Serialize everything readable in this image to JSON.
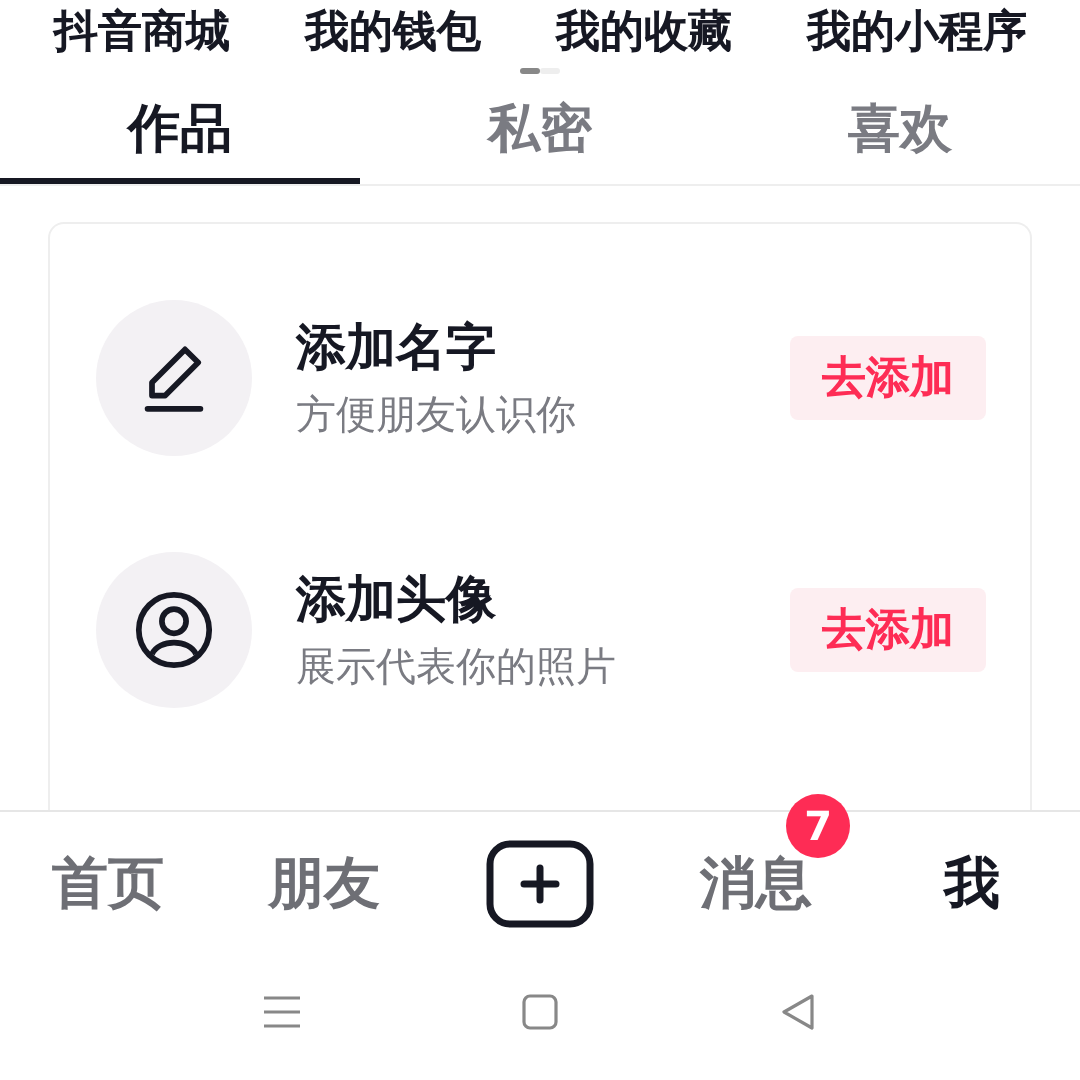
{
  "shortcuts": [
    "抖音商城",
    "我的钱包",
    "我的收藏",
    "我的小程序"
  ],
  "page_indicator": [
    {
      "selected": true
    },
    {
      "selected": false
    }
  ],
  "tabs": [
    {
      "label": "作品",
      "selected": true
    },
    {
      "label": "私密",
      "selected": false
    },
    {
      "label": "喜欢",
      "selected": false
    }
  ],
  "tasks": [
    {
      "kind": "name",
      "title": "添加名字",
      "subtitle": "方便朋友认识你",
      "action": "去添加"
    },
    {
      "kind": "avatar",
      "title": "添加头像",
      "subtitle": "展示代表你的照片",
      "action": "去添加"
    }
  ],
  "nav": [
    {
      "kind": "tab",
      "label": "首页",
      "selected": false
    },
    {
      "kind": "tab",
      "label": "朋友",
      "selected": false
    },
    {
      "kind": "create"
    },
    {
      "kind": "tab",
      "label": "消息",
      "selected": false,
      "badge": "7"
    },
    {
      "kind": "tab",
      "label": "我",
      "selected": true
    }
  ]
}
